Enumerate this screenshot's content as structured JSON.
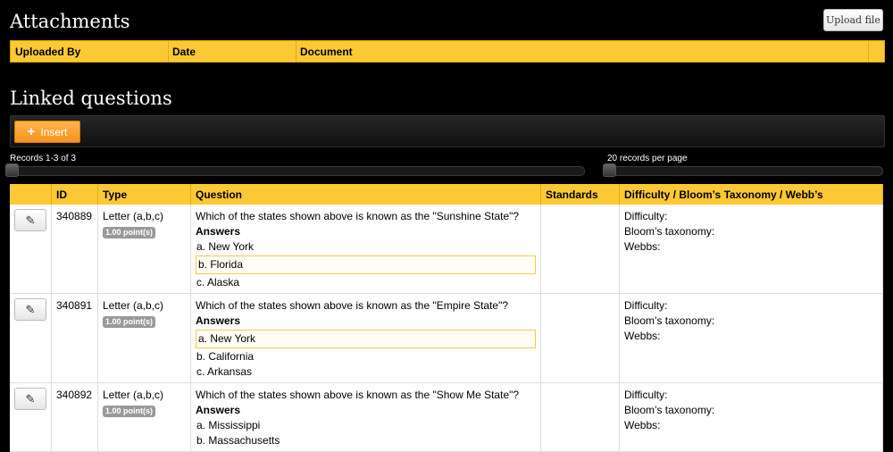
{
  "attachments": {
    "title": "Attachments",
    "upload_label": "Upload file",
    "columns": [
      "Uploaded By",
      "Date",
      "Document"
    ]
  },
  "linked": {
    "title": "Linked questions",
    "insert_label": "Insert",
    "records_label": "Records 1-3 of 3",
    "per_page_label": "20 records per page"
  },
  "table": {
    "columns": [
      "ID",
      "Type",
      "Question",
      "Standards",
      "Difficulty / Bloom’s Taxonomy / Webb’s"
    ],
    "answers_label": "Answers",
    "meta_labels": [
      "Difficulty:",
      "Bloom’s taxonomy:",
      "Webbs:"
    ],
    "rows": [
      {
        "id": "340889",
        "type": "Letter (a,b,c)",
        "points": "1.00 point(s)",
        "question": "Which of the states shown above is known as the \"Sunshine State\"?",
        "answers": [
          "a. New York",
          "b. Florida",
          "c. Alaska"
        ],
        "correct_index": 1
      },
      {
        "id": "340891",
        "type": "Letter (a,b,c)",
        "points": "1.00 point(s)",
        "question": "Which of the states shown above is known as the \"Empire State\"?",
        "answers": [
          "a. New York",
          "b. California",
          "c. Arkansas"
        ],
        "correct_index": 0
      },
      {
        "id": "340892",
        "type": "Letter (a,b,c)",
        "points": "1.00 point(s)",
        "question": "Which of the states shown above is known as the \"Show Me State\"?",
        "answers": [
          "a. Mississippi",
          "b. Massachusetts"
        ],
        "correct_index": -1
      }
    ]
  },
  "colors": {
    "header_yellow": "#fcc934",
    "insert_orange": "#f7931e",
    "background": "#000000"
  },
  "icons": {
    "edit": "pencil-icon",
    "insert": "plus-icon"
  }
}
